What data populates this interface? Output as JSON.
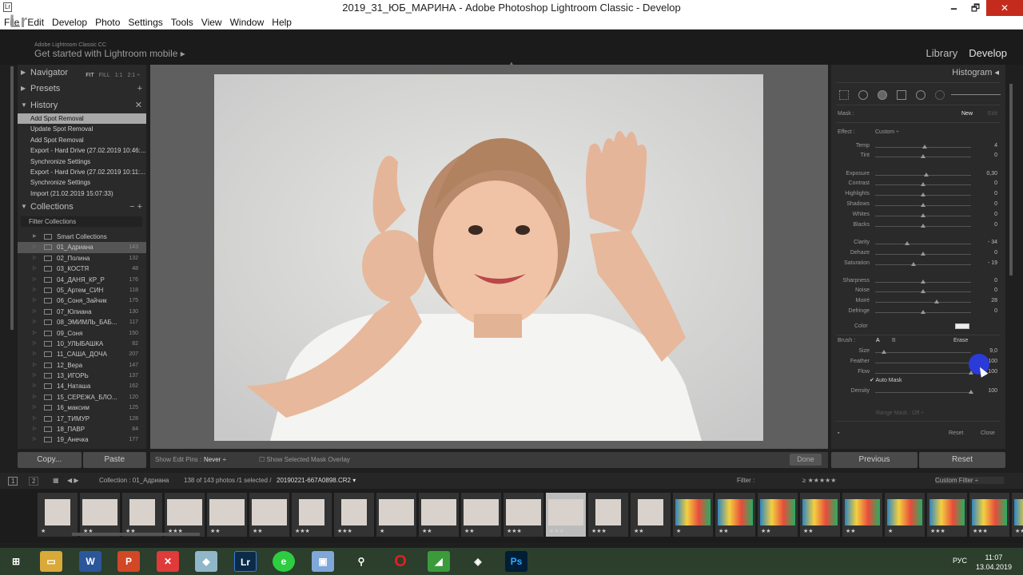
{
  "window": {
    "title": "2019_31_ЮБ_МАРИНА - Adobe Photoshop Lightroom Classic - Develop",
    "minimize": "🗕",
    "restore": "🗗",
    "close": "✕"
  },
  "menu": [
    "File",
    "Edit",
    "Develop",
    "Photo",
    "Settings",
    "Tools",
    "View",
    "Window",
    "Help"
  ],
  "identity": {
    "logo": "Lr",
    "small": "Adobe Lightroom Classic CC",
    "big": "Get started with Lightroom mobile ▸",
    "modules": [
      "Library",
      "Develop"
    ]
  },
  "left": {
    "navigator": "Navigator",
    "nav_modes": [
      "FIT",
      "FILL",
      "1:1",
      "2:1 ÷"
    ],
    "presets": "Presets",
    "history": "History",
    "collections": "Collections",
    "history_items": [
      "Add Spot Removal",
      "Update Spot Removal",
      "Add Spot Removal",
      "Export - Hard Drive (27.02.2019 10:46:...",
      "Synchronize Settings",
      "Export - Hard Drive (27.02.2019 10:11:...",
      "Synchronize Settings",
      "Import (21.02.2019 15:07:33)"
    ],
    "filter_collections": "Filter Collections",
    "collection_items": [
      {
        "name": "Smart Collections",
        "count": ""
      },
      {
        "name": "01_Адриана",
        "count": "143"
      },
      {
        "name": "02_Полина",
        "count": "132"
      },
      {
        "name": "03_КОСТЯ",
        "count": "48"
      },
      {
        "name": "04_ДАНЯ_КР_Р",
        "count": "176"
      },
      {
        "name": "05_Артем_СИН",
        "count": "118"
      },
      {
        "name": "06_Соня_Зайчик",
        "count": "175"
      },
      {
        "name": "07_Юлиана",
        "count": "130"
      },
      {
        "name": "08_ЭМИМЛЬ_БАБ...",
        "count": "117"
      },
      {
        "name": "09_Соня",
        "count": "150"
      },
      {
        "name": "10_УЛЫБАШКА",
        "count": "82"
      },
      {
        "name": "11_САША_ДОЧА",
        "count": "207"
      },
      {
        "name": "12_Вера",
        "count": "147"
      },
      {
        "name": "13_ИГОРЬ",
        "count": "137"
      },
      {
        "name": "14_Наташа",
        "count": "162"
      },
      {
        "name": "15_СЕРЕЖА_БЛО...",
        "count": "120"
      },
      {
        "name": "16_максим",
        "count": "125"
      },
      {
        "name": "17_ТИМУР",
        "count": "128"
      },
      {
        "name": "18_ПАВР",
        "count": "84"
      },
      {
        "name": "19_Анечка",
        "count": "177"
      }
    ],
    "copy": "Copy...",
    "paste": "Paste"
  },
  "toolbar": {
    "show_pins": "Show Edit Pins :",
    "pins_value": "Never ÷",
    "mask_overlay": "Show Selected Mask Overlay",
    "done": "Done"
  },
  "right": {
    "histogram": "Histogram ◂",
    "mask": "Mask :",
    "new": "New",
    "edit": "Edit",
    "effect": "Effect :",
    "effect_value": "Custom ÷",
    "sliders": [
      {
        "label": "Temp",
        "value": "4",
        "pos": 0.52
      },
      {
        "label": "Tint",
        "value": "0",
        "pos": 0.5
      },
      {
        "label": "Exposure",
        "value": "0,30",
        "pos": 0.53
      },
      {
        "label": "Contrast",
        "value": "0",
        "pos": 0.5
      },
      {
        "label": "Highlights",
        "value": "0",
        "pos": 0.5
      },
      {
        "label": "Shadows",
        "value": "0",
        "pos": 0.5
      },
      {
        "label": "Whites",
        "value": "0",
        "pos": 0.5
      },
      {
        "label": "Blacks",
        "value": "0",
        "pos": 0.5
      },
      {
        "label": "Clarity",
        "value": "- 34",
        "pos": 0.33
      },
      {
        "label": "Dehaze",
        "value": "0",
        "pos": 0.5
      },
      {
        "label": "Saturation",
        "value": "- 19",
        "pos": 0.4
      },
      {
        "label": "Sharpness",
        "value": "0",
        "pos": 0.5
      },
      {
        "label": "Noise",
        "value": "0",
        "pos": 0.5
      },
      {
        "label": "Moiré",
        "value": "28",
        "pos": 0.64
      },
      {
        "label": "Defringe",
        "value": "0",
        "pos": 0.5
      }
    ],
    "color": "Color",
    "brush": "Brush :",
    "brush_a": "A",
    "brush_b": "B",
    "erase": "Erase",
    "brush_sliders": [
      {
        "label": "Size",
        "value": "9,0",
        "pos": 0.09
      },
      {
        "label": "Feather",
        "value": "100",
        "pos": 1.0
      },
      {
        "label": "Flow",
        "value": "100",
        "pos": 1.0
      }
    ],
    "auto_mask": "Auto Mask",
    "density": {
      "label": "Density",
      "value": "100",
      "pos": 1.0
    },
    "range_mask": "Range Mask : Off ÷",
    "reset": "Reset",
    "close": "Close",
    "previous": "Previous",
    "reset_btn": "Reset"
  },
  "filmbar": {
    "collection": "Collection : 01_Адриана",
    "count": "138 of 143 photos /1 selected /",
    "file": "20190221-667A0898.CR2 ▾",
    "filter": "Filter :",
    "stars": "≥ ★★★★★",
    "custom": "Custom Filter ÷",
    "pages": [
      "1",
      "2"
    ]
  },
  "thumb_stars": [
    "★",
    "★★",
    "★★",
    "★★★",
    "★★",
    "★★",
    "★★★",
    "★★★",
    "★",
    "★★",
    "★★",
    "★★★",
    "★★★",
    "★★★",
    "★★",
    "★",
    "★★",
    "★★",
    "★★",
    "★★",
    "★",
    "★★★",
    "★★★",
    "★★"
  ],
  "taskbar": {
    "time": "11:07",
    "date": "13.04.2019",
    "lang": "РУС"
  }
}
